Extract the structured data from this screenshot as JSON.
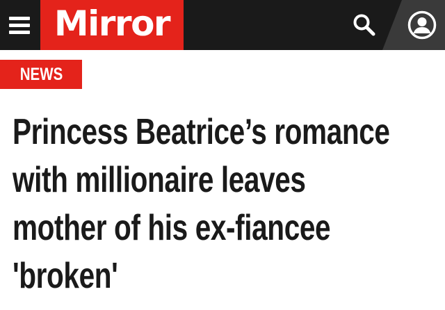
{
  "header": {
    "logo_text": "Mirror",
    "menu_icon": "hamburger-menu-icon",
    "search_icon": "search-icon",
    "account_icon": "user-account-icon"
  },
  "article": {
    "section": "NEWS",
    "headline": "Princess Beatrice’s romance with millionaire leaves mother of his ex-fiancee 'broken'"
  },
  "colors": {
    "brand_red": "#e4231b",
    "header_bg": "#1a1a1a",
    "account_bg": "#3a3a3a",
    "text": "#1a1a1a",
    "background": "#ffffff"
  }
}
